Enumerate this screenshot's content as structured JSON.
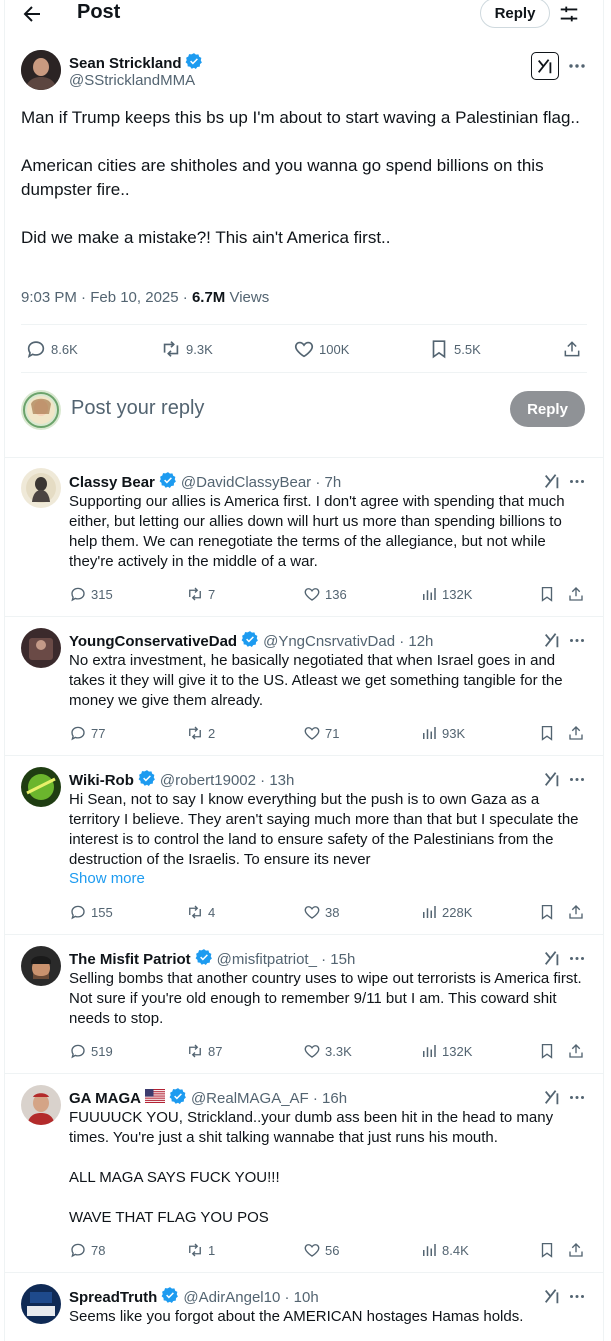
{
  "header": {
    "title": "Post",
    "reply_label": "Reply"
  },
  "post": {
    "author": "Sean Strickland",
    "handle": "@SStricklandMMA",
    "text": "Man if Trump keeps this bs up I'm about to start waving a Palestinian flag..\n\nAmerican cities are shitholes and you wanna go spend billions on this dumpster fire..\n\nDid we make a mistake?! This ain't America first..",
    "timestamp": "9:03 PM · Feb 10, 2025 · ",
    "views_count": "6.7M",
    "views_label": " Views",
    "stats": {
      "replies": "8.6K",
      "reposts": "9.3K",
      "likes": "100K",
      "bookmarks": "5.5K"
    }
  },
  "compose": {
    "placeholder": "Post your reply",
    "button": "Reply"
  },
  "replies": [
    {
      "name": "Classy Bear",
      "handle": "@DavidClassyBear · 7h",
      "text": "Supporting our allies is America first. I don't agree with spending that much either, but letting our allies down will hurt us more than spending billions to help them. We can renegotiate the terms of the allegiance, but not while they're actively in the middle of a war.",
      "replies": "315",
      "reposts": "7",
      "likes": "136",
      "views": "132K"
    },
    {
      "name": "YoungConservativeDad",
      "handle": "@YngCnsrvativDad · 12h",
      "text": "No extra investment, he basically negotiated that when Israel goes in and takes it they will give it to the US. Atleast we get something tangible for the money we give them already.",
      "replies": "77",
      "reposts": "2",
      "likes": "71",
      "views": "93K"
    },
    {
      "name": "Wiki-Rob",
      "handle": "@robert19002 · 13h",
      "text": "Hi Sean, not to say I know everything but the push is to own Gaza as a territory I believe. They aren't saying much more than that but I speculate the interest is to control the land to ensure safety of the Palestinians from the destruction of the Israelis. To ensure its never",
      "show_more": "Show more",
      "replies": "155",
      "reposts": "4",
      "likes": "38",
      "views": "228K"
    },
    {
      "name": "The Misfit Patriot",
      "handle": "@misfitpatriot_ · 15h",
      "text": "Selling bombs that another country uses to wipe out terrorists is America first. Not sure if you're old enough to remember 9/11 but I am. This coward shit needs to stop.",
      "replies": "519",
      "reposts": "87",
      "likes": "3.3K",
      "views": "132K"
    },
    {
      "name": "GA MAGA",
      "handle": "@RealMAGA_AF · 16h",
      "text": "FUUUUCK YOU, Strickland..your dumb ass been hit in the head to many times. You're just a shit talking wannabe that just runs his mouth.\n\nALL MAGA SAYS FUCK YOU!!!\n\nWAVE THAT FLAG YOU POS",
      "replies": "78",
      "reposts": "1",
      "likes": "56",
      "views": "8.4K"
    },
    {
      "name": "SpreadTruth",
      "handle": "@AdirAngel10 · 10h",
      "text": "Seems like you forgot about the AMERICAN hostages Hamas holds."
    }
  ],
  "colors": {
    "accent": "#1d9bf0",
    "text": "#0f1419",
    "muted": "#536471",
    "verified": "#1d9bf0"
  }
}
